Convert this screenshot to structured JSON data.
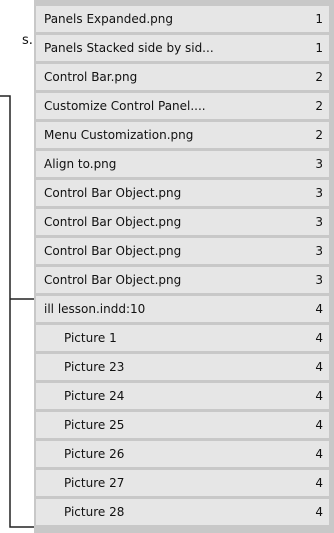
{
  "left_fragment": {
    "text": "s."
  },
  "rows": [
    {
      "name": "Panels Expanded.png",
      "count": "1"
    },
    {
      "name": "Panels Stacked side by sid...",
      "count": "1"
    },
    {
      "name": "Control Bar.png",
      "count": "2"
    },
    {
      "name": "Customize Control Panel....",
      "count": "2"
    },
    {
      "name": "Menu Customization.png",
      "count": "2"
    },
    {
      "name": "Align to.png",
      "count": "3"
    },
    {
      "name": "Control Bar Object.png",
      "count": "3"
    },
    {
      "name": "Control Bar Object.png",
      "count": "3"
    },
    {
      "name": "Control Bar Object.png",
      "count": "3"
    },
    {
      "name": "Control Bar Object.png",
      "count": "3"
    },
    {
      "name": "ill lesson.indd:10",
      "count": "4"
    },
    {
      "name": "Picture 1",
      "count": "4"
    },
    {
      "name": "Picture 23",
      "count": "4"
    },
    {
      "name": "Picture 24",
      "count": "4"
    },
    {
      "name": "Picture 25",
      "count": "4"
    },
    {
      "name": "Picture 26",
      "count": "4"
    },
    {
      "name": "Picture 27",
      "count": "4"
    },
    {
      "name": "Picture 28",
      "count": "4"
    }
  ]
}
